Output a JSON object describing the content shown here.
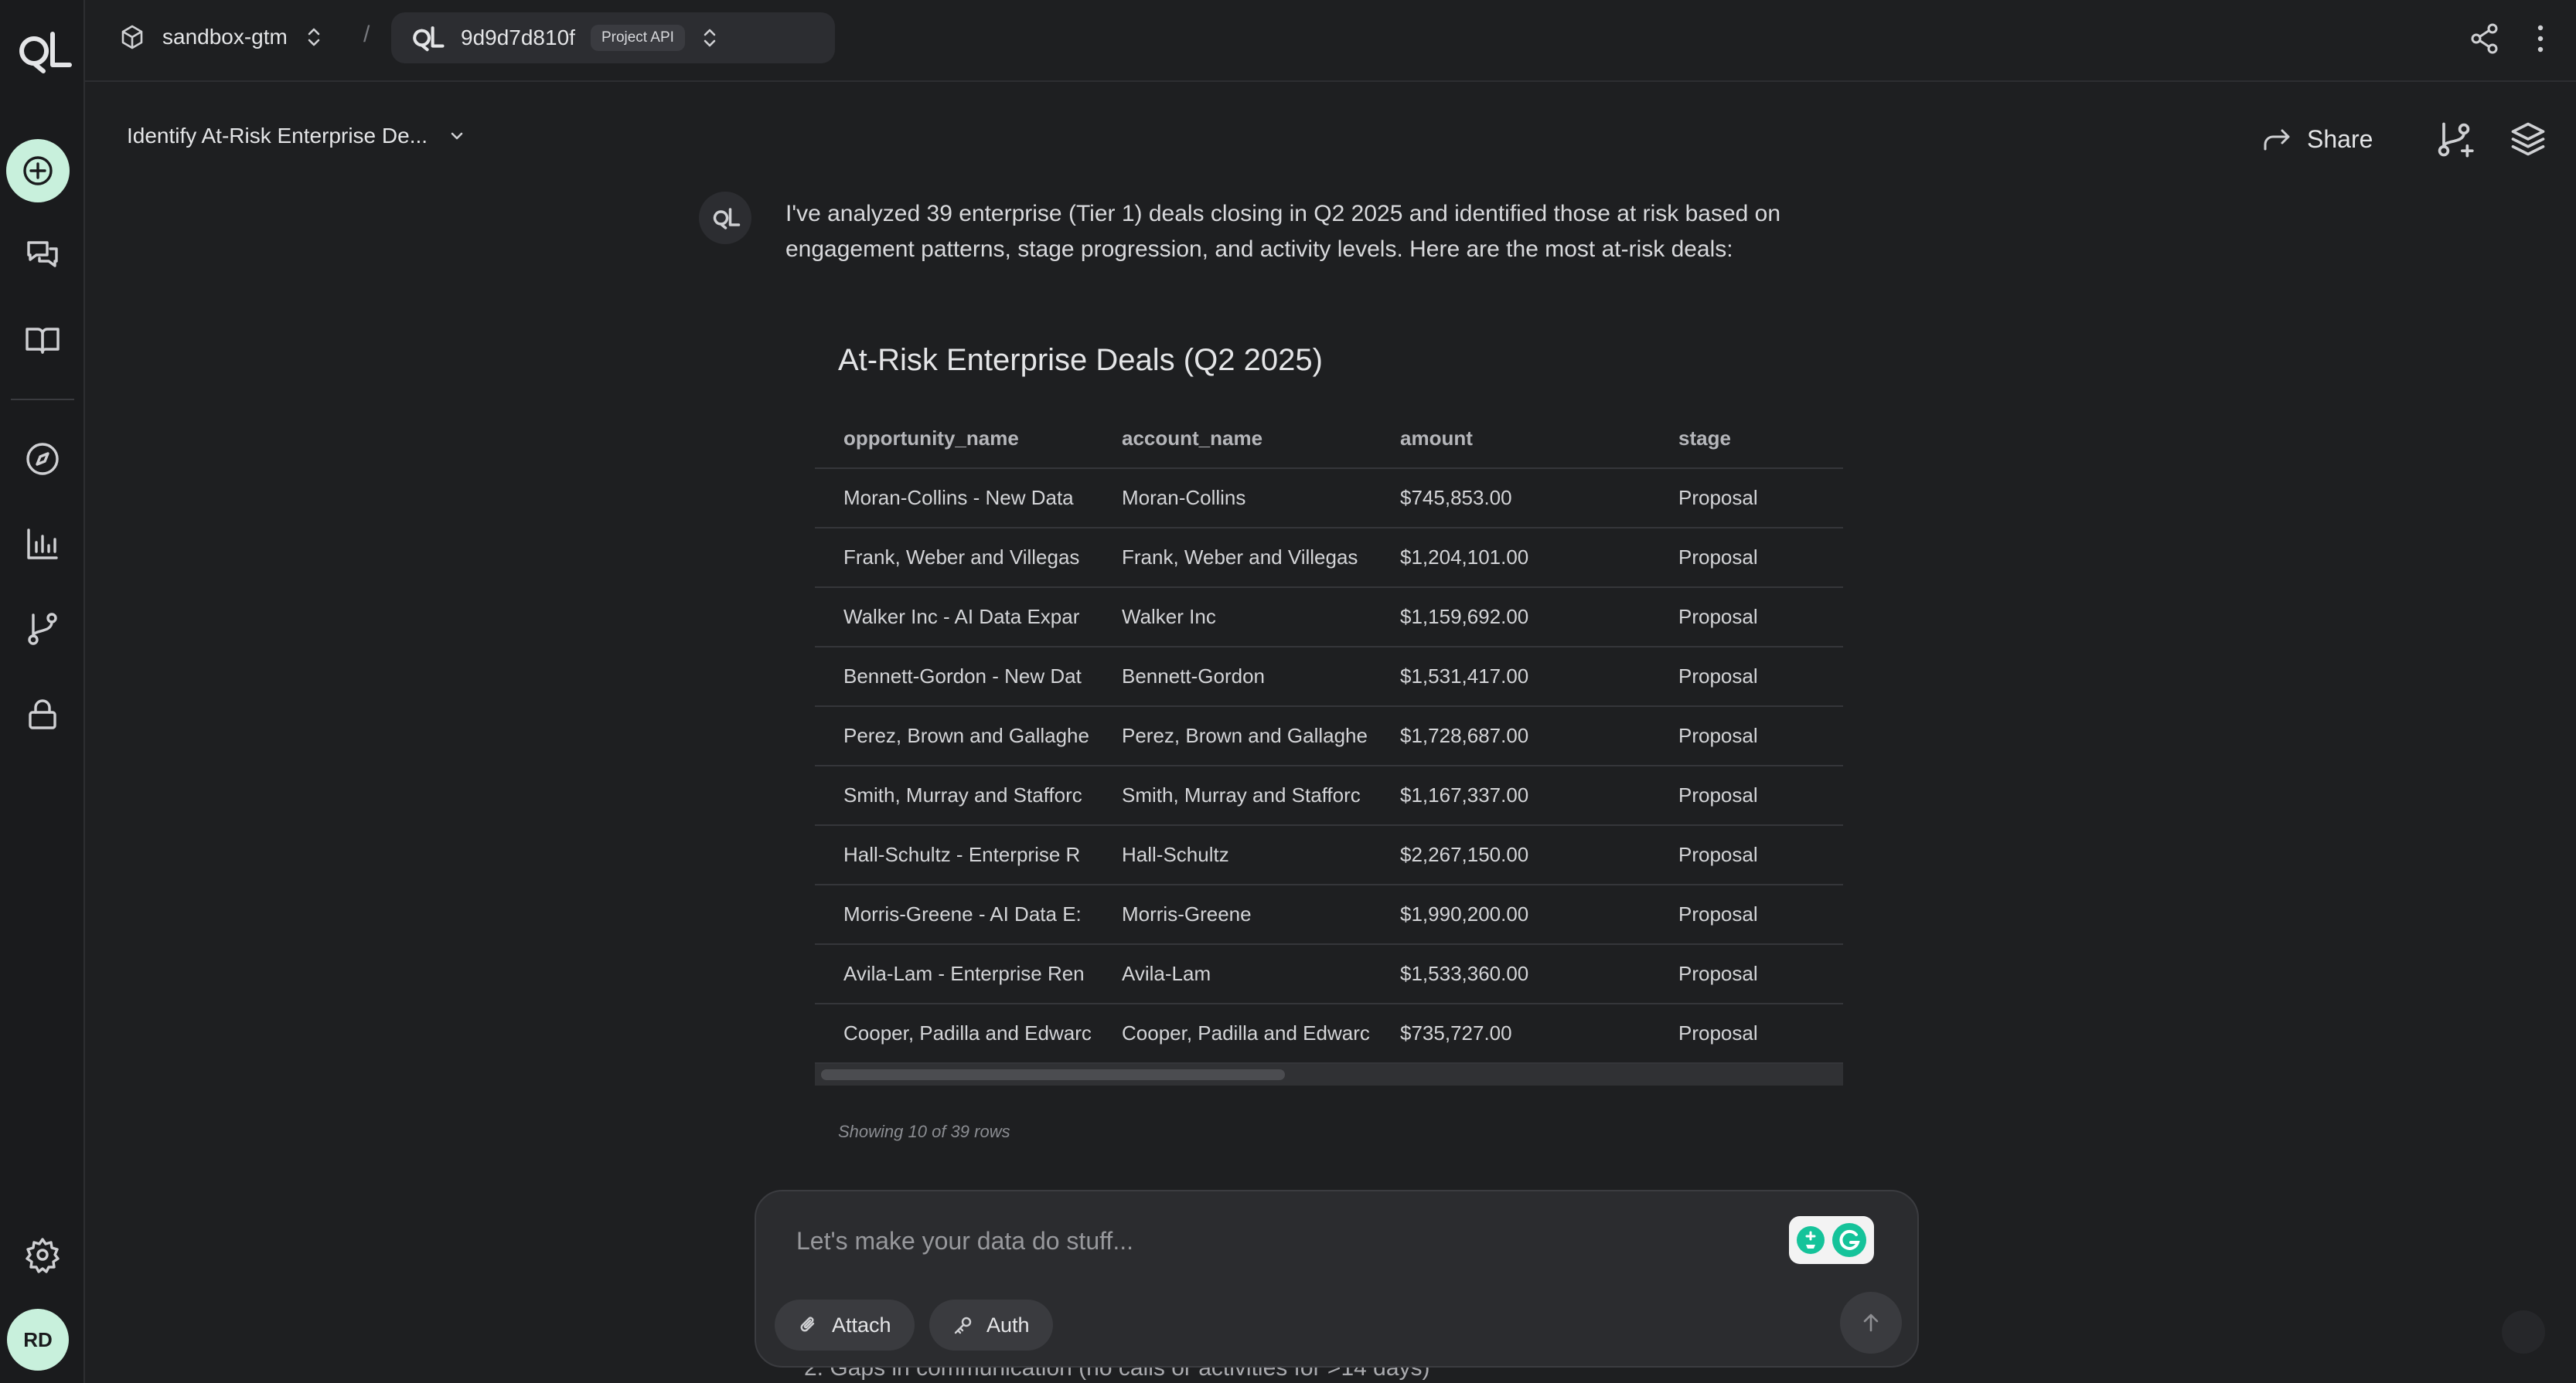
{
  "topbar": {
    "workspace": "sandbox-gtm",
    "separator": "/",
    "project_id": "9d9d7d810f",
    "project_tag": "Project API"
  },
  "sidebar": {
    "avatar_initials": "RD",
    "logo_text": "QL",
    "items": [
      "new-chat",
      "chats",
      "docs",
      "explore",
      "charts",
      "branches",
      "security",
      "settings"
    ]
  },
  "thread": {
    "title": "Identify At-Risk Enterprise De...",
    "share_label": "Share"
  },
  "message": {
    "avatar_text": "QL",
    "text": "I've analyzed 39 enterprise (Tier 1) deals closing in Q2 2025 and identified those at risk based on engagement patterns, stage progression, and activity levels. Here are the most at-risk deals:"
  },
  "table": {
    "title": "At-Risk Enterprise Deals (Q2 2025)",
    "columns": [
      "opportunity_name",
      "account_name",
      "amount",
      "stage"
    ],
    "rows": [
      [
        "Moran-Collins - New Data",
        "Moran-Collins",
        "$745,853.00",
        "Proposal"
      ],
      [
        "Frank, Weber and Villegas",
        "Frank, Weber and Villegas",
        "$1,204,101.00",
        "Proposal"
      ],
      [
        "Walker Inc - AI Data Expar",
        "Walker Inc",
        "$1,159,692.00",
        "Proposal"
      ],
      [
        "Bennett-Gordon - New Dat",
        "Bennett-Gordon",
        "$1,531,417.00",
        "Proposal"
      ],
      [
        "Perez, Brown and Gallaghe",
        "Perez, Brown and Gallaghe",
        "$1,728,687.00",
        "Proposal"
      ],
      [
        "Smith, Murray and Stafforc",
        "Smith, Murray and Stafforc",
        "$1,167,337.00",
        "Proposal"
      ],
      [
        "Hall-Schultz - Enterprise R",
        "Hall-Schultz",
        "$2,267,150.00",
        "Proposal"
      ],
      [
        "Morris-Greene - AI Data E:",
        "Morris-Greene",
        "$1,990,200.00",
        "Proposal"
      ],
      [
        "Avila-Lam - Enterprise Ren",
        "Avila-Lam",
        "$1,533,360.00",
        "Proposal"
      ],
      [
        "Cooper, Padilla and Edwarc",
        "Cooper, Padilla and Edwarc",
        "$735,727.00",
        "Proposal"
      ]
    ],
    "row_count_text": "Showing 10 of 39 rows"
  },
  "peek_text": "2. Gaps in communication (no calls or activities for >14 days)",
  "composer": {
    "placeholder": "Let's make your data do stuff...",
    "attach_label": "Attach",
    "auth_label": "Auth"
  },
  "colors": {
    "background": "#1e1f21",
    "sidebar": "#1a1b1d",
    "accent": "#c8f0dc",
    "grammarly": "#15c39a"
  }
}
